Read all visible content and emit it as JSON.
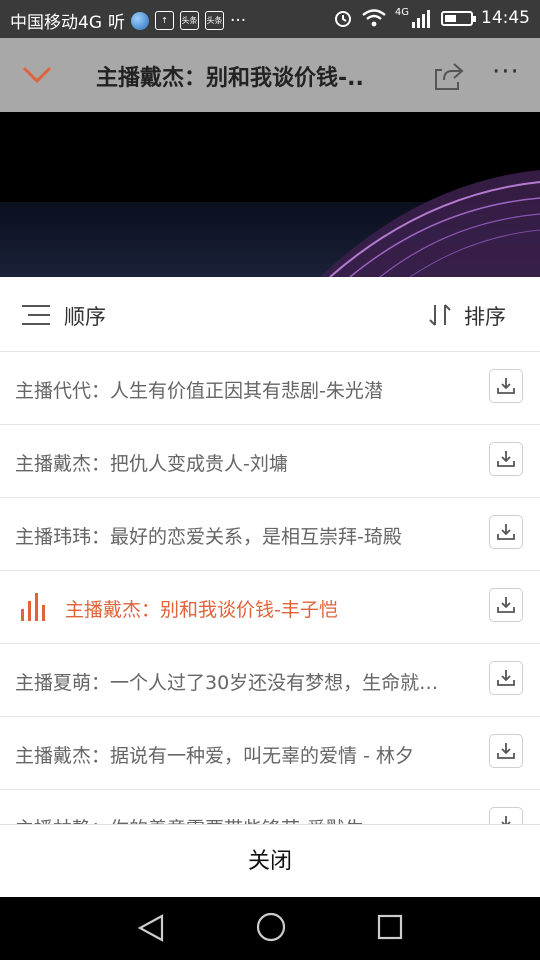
{
  "status_bar": {
    "carrier": "中国移动4G",
    "app_glyph": "听",
    "mini_icon_1": "头条",
    "mini_icon_2": "头条",
    "more": "···",
    "network": "4G",
    "time": "14:45",
    "battery_level": 0.45,
    "icons": [
      "listen-app-icon",
      "ball-app-icon",
      "upload-notification-icon",
      "toutiao-icon",
      "toutiao-icon",
      "alarm-icon",
      "wifi-icon",
      "signal-icon",
      "battery-icon"
    ]
  },
  "app_bar": {
    "title": "主播戴杰：别和我谈价钱-..",
    "more_label": "···",
    "icons": [
      "chevron-down-icon",
      "share-icon",
      "more-icon"
    ]
  },
  "playlist": {
    "order_label": "顺序",
    "sort_label": "排序",
    "items": [
      {
        "title": "主播代代：人生有价值正因其有悲剧-朱光潜",
        "active": false
      },
      {
        "title": "主播戴杰：把仇人变成贵人-刘墉",
        "active": false
      },
      {
        "title": "主播玮玮：最好的恋爱关系，是相互崇拜-琦殿",
        "active": false
      },
      {
        "title": "主播戴杰：别和我谈价钱-丰子恺",
        "active": true
      },
      {
        "title": "主播夏萌：一个人过了30岁还没有梦想，生命就…",
        "active": false
      },
      {
        "title": "主播戴杰：据说有一种爱，叫无辜的爱情 - 林夕",
        "active": false
      },
      {
        "title": "主播林静：你的善意需要带些锋芒-爱默生",
        "active": false
      }
    ],
    "close_label": "关闭"
  },
  "colors": {
    "accent": "#e0633b",
    "app_bar_bg": "#a8a8a8",
    "status_bar_bg": "#3a3a3a"
  },
  "nav_bar": {
    "icons": [
      "back-triangle-icon",
      "home-circle-icon",
      "recent-square-icon"
    ]
  }
}
